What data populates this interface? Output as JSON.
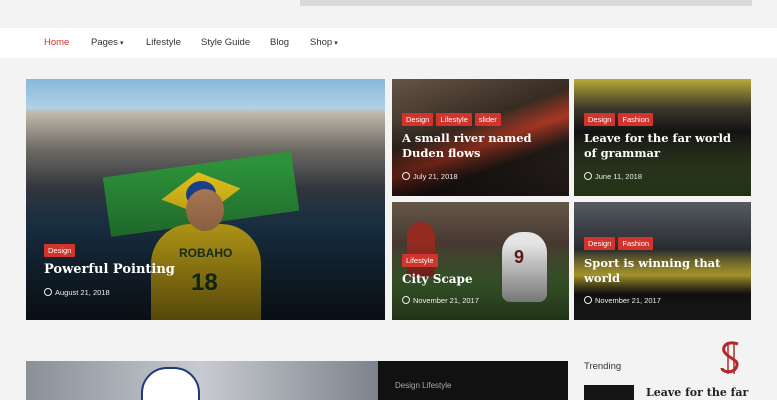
{
  "nav": {
    "items": [
      "Home",
      "Pages",
      "Lifestyle",
      "Style Guide",
      "Blog",
      "Shop"
    ],
    "active": "Home",
    "dropdown_items": [
      "Pages",
      "Shop"
    ]
  },
  "featured": {
    "tags": [
      "Design"
    ],
    "title": "Powerful Pointing",
    "date": "August 21, 2018"
  },
  "cards": [
    {
      "tags": [
        "Design",
        "Lifestyle",
        "slider"
      ],
      "title": "A small river named Duden flows",
      "date": "July 21, 2018"
    },
    {
      "tags": [
        "Design",
        "Fashion"
      ],
      "title": "Leave for the far world of grammar",
      "date": "June 11, 2018"
    },
    {
      "tags": [
        "Lifestyle"
      ],
      "title": "City Scape",
      "date": "November 21, 2017"
    },
    {
      "tags": [
        "Design",
        "Fashion"
      ],
      "title": "Sport is winning that world",
      "date": "November 21, 2017"
    }
  ],
  "bottom": {
    "categories": "Design  Lifestyle",
    "trending_label": "Trending",
    "trending_title": "Leave for the far"
  },
  "colors": {
    "accent": "#d0342c",
    "nav_bg": "#ffffff",
    "page_bg": "#f3f3f3"
  },
  "icons": {
    "date": "clock-icon",
    "dropdown": "caret-down-icon",
    "logo": "site-logo-icon"
  }
}
